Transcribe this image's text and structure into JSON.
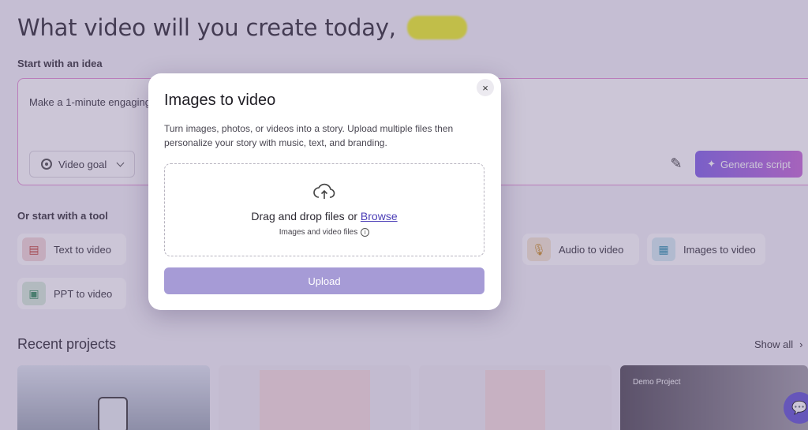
{
  "headline": "What video will you create today,",
  "idea_section_label": "Start with an idea",
  "idea_text": "Make a 1-minute engaging",
  "video_goal_label": "Video goal",
  "generate_script_label": "Generate script",
  "tool_section_label": "Or start with a tool",
  "tools": [
    {
      "label": "Text to video",
      "icon": "text-to-video-icon",
      "color": "#f3d6d6"
    },
    {
      "label": "PPT to video",
      "icon": "presentation-icon",
      "color": "#d5ecd9"
    },
    {
      "label": "Audio to video",
      "icon": "microphone-icon",
      "color": "#f6e7d0"
    },
    {
      "label": "Images to video",
      "icon": "images-icon",
      "color": "#d3ecf3"
    }
  ],
  "recent_projects_label": "Recent projects",
  "show_all_label": "Show all",
  "demo_project_label": "Demo Project",
  "modal": {
    "title": "Images to video",
    "description": "Turn images, photos, or videos into a story. Upload multiple files then personalize your story with music, text, and branding.",
    "drop_text": "Drag and drop files or",
    "browse_label": "Browse",
    "file_types": "Images and video files",
    "upload_label": "Upload",
    "close_label": "×"
  }
}
